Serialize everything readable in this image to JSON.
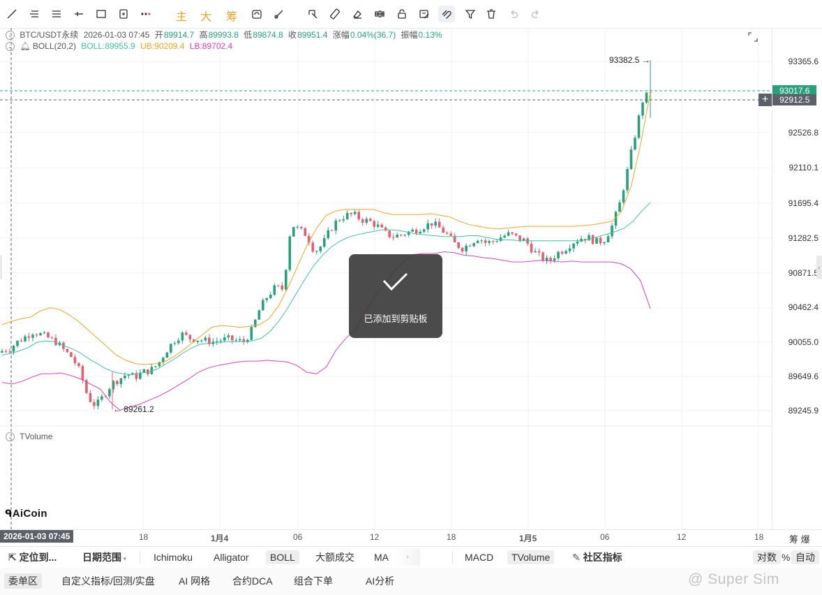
{
  "toolbar": {
    "text_tools": [
      "主",
      "大",
      "筹"
    ],
    "icons": [
      "trend-line-icon",
      "horizontal-lines-icon",
      "parallel-lines-icon",
      "ray-icon",
      "rectangle-icon",
      "measure-icon",
      "more-icon",
      "sync-icon",
      "brush-icon",
      "select-icon",
      "ruler-icon",
      "eraser-icon",
      "pattern-icon",
      "lock-icon",
      "note-icon",
      "magnet-icon",
      "filter-icon",
      "trash-icon",
      "undo-icon",
      "redo-icon"
    ]
  },
  "info": {
    "symbol": "BTC/USDT永续",
    "datetime": "2026-01-03 07:45",
    "open_label": "开",
    "open": "89914.7",
    "high_label": "高",
    "high": "89993.8",
    "low_label": "低",
    "low": "89874.8",
    "close_label": "收",
    "close": "89951.4",
    "change_label": "涨幅",
    "change": "0.04%(36.7)",
    "amp_label": "振幅",
    "amp": "0.13%",
    "boll_name": "BOLL(20,2)",
    "boll": "BOLL:89955.9",
    "ub": "UB:90209.4",
    "lb": "LB:89702.4",
    "volume_name": "TVolume"
  },
  "colors": {
    "up": "#26a17b",
    "down": "#e15f6e",
    "mid": "#3fc2a3",
    "ub": "#f0a521",
    "lb": "#e040b4",
    "tag_green": "#26a17b",
    "tag_grey": "#5c6068"
  },
  "price_axis": [
    "93365.6",
    "92526.8",
    "92110.1",
    "91695.4",
    "91282.5",
    "90871.5",
    "90462.4",
    "90055.0",
    "89649.6",
    "89245.9"
  ],
  "tags": {
    "last": "93017.6",
    "cursor": "92912.5"
  },
  "annotations": {
    "high": "93382.5",
    "low": "89261.2"
  },
  "time_axis": {
    "labels": [
      "18",
      "1月4",
      "06",
      "12",
      "18",
      "1月5",
      "06",
      "12",
      "18"
    ],
    "cursor": "2026-01-03 07:45",
    "right": "筹 爆"
  },
  "toast": {
    "message": "已添加到剪贴板"
  },
  "logo": "AiCoin",
  "watermark": "@ Super Sim",
  "bottom1": {
    "locate": "定位到...",
    "range": "日期范围",
    "indicators": [
      "Ichimoku",
      "Alligator",
      "BOLL",
      "大额成交",
      "MA"
    ],
    "sub": [
      "MACD",
      "TVolume"
    ],
    "community": "社区指标",
    "log": "对数",
    "pct": "%",
    "auto": "自动"
  },
  "bottom2": [
    "委单区",
    "自定义指标/回测/实盘",
    "AI 网格",
    "合约DCA",
    "组合下单",
    "AI分析"
  ],
  "chart_data": {
    "type": "candlestick",
    "ylim": [
      89100,
      93500
    ],
    "y_ticks": [
      93365.6,
      92526.8,
      92110.1,
      91695.4,
      91282.5,
      90871.5,
      90462.4,
      90055.0,
      89649.6,
      89245.9
    ],
    "high_marker": 93382.5,
    "low_marker": 89261.2,
    "close_path": [
      89951,
      89980,
      90060,
      90120,
      90180,
      90140,
      90100,
      90050,
      89950,
      89870,
      89700,
      89400,
      89300,
      89420,
      89560,
      89620,
      89680,
      89640,
      89700,
      89720,
      89800,
      89950,
      90070,
      90150,
      90100,
      90090,
      90070,
      90060,
      90080,
      90090,
      90070,
      90060,
      90200,
      90450,
      90600,
      90700,
      90680,
      91450,
      91380,
      91320,
      91120,
      91200,
      91380,
      91500,
      91550,
      91560,
      91500,
      91480,
      91430,
      91340,
      91300,
      91320,
      91350,
      91380,
      91420,
      91460,
      91400,
      91320,
      91210,
      91160,
      91230,
      91290,
      91220,
      91250,
      91300,
      91330,
      91280,
      91250,
      91130,
      91050,
      91000,
      91100,
      91150,
      91230,
      91280,
      91290,
      91240,
      91250,
      91400,
      91660,
      92050,
      92480,
      92900,
      93017
    ],
    "boll_mid": [
      89900,
      89920,
      89950,
      89990,
      90050,
      90070,
      90060,
      90020,
      89980,
      89930,
      89860,
      89800,
      89740,
      89700,
      89680,
      89670,
      89690,
      89700,
      89740,
      89800,
      89860,
      89930,
      89990,
      90030,
      90040,
      90050,
      90060,
      90060,
      90060,
      90070,
      90100,
      90180,
      90300,
      90450,
      90620,
      90790,
      90950,
      91070,
      91170,
      91240,
      91290,
      91320,
      91340,
      91360,
      91380,
      91380,
      91370,
      91350,
      91330,
      91320,
      91310,
      91300,
      91300,
      91300,
      91310,
      91310,
      91290,
      91270,
      91260,
      91260,
      91250,
      91250,
      91250,
      91250,
      91250,
      91250,
      91250,
      91250,
      91270,
      91300,
      91330,
      91360,
      91400,
      91480,
      91600,
      91700
    ],
    "boll_ub": [
      90260,
      90300,
      90330,
      90350,
      90420,
      90460,
      90440,
      90380,
      90300,
      90200,
      90100,
      90000,
      89900,
      89840,
      89800,
      89790,
      89800,
      89820,
      89880,
      89960,
      90050,
      90140,
      90230,
      90250,
      90240,
      90230,
      90240,
      90260,
      90330,
      90480,
      90700,
      90950,
      91200,
      91400,
      91550,
      91600,
      91620,
      91620,
      91620,
      91620,
      91580,
      91560,
      91560,
      91560,
      91560,
      91570,
      91550,
      91530,
      91480,
      91440,
      91420,
      91400,
      91390,
      91400,
      91410,
      91420,
      91420,
      91420,
      91420,
      91420,
      91420,
      91430,
      91440,
      91460,
      91480,
      91600,
      91900,
      92400,
      93000
    ],
    "boll_lb": [
      89580,
      89560,
      89590,
      89640,
      89680,
      89680,
      89690,
      89660,
      89620,
      89560,
      89500,
      89350,
      89250,
      89290,
      89320,
      89370,
      89420,
      89480,
      89550,
      89620,
      89700,
      89750,
      89780,
      89800,
      89820,
      89830,
      89830,
      89840,
      89830,
      89820,
      89780,
      89700,
      89680,
      89760,
      89960,
      90100,
      90200,
      90420,
      90600,
      90750,
      90900,
      91020,
      91090,
      91100,
      91100,
      91120,
      91110,
      91080,
      91070,
      91050,
      91040,
      91020,
      91000,
      91000,
      91010,
      91020,
      91010,
      91000,
      91010,
      91000,
      91000,
      91000,
      91000,
      90980,
      90920,
      90780,
      90450
    ]
  }
}
